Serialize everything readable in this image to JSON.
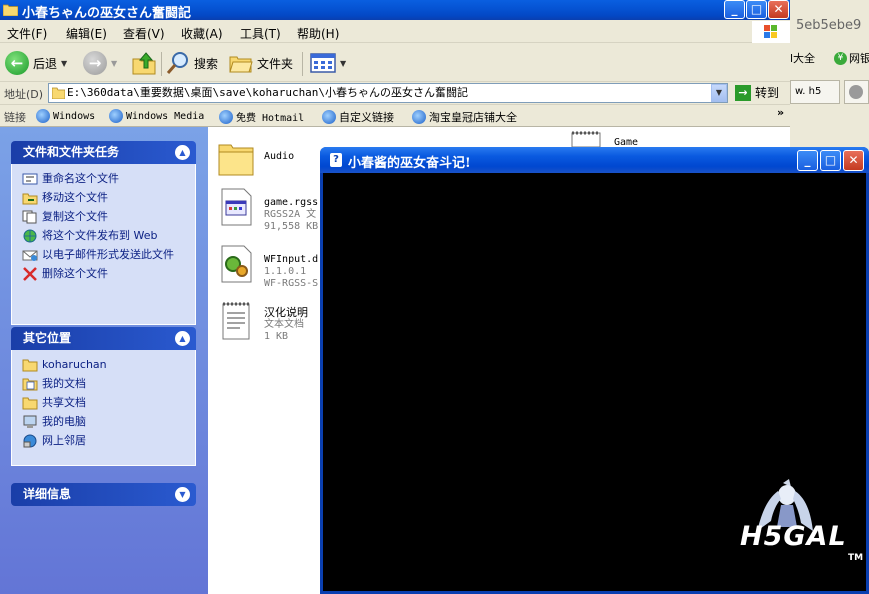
{
  "explorer": {
    "title": "小春ちゃんの巫女さん奮闘記",
    "window_buttons": [
      "minimize",
      "maximize",
      "close"
    ],
    "menu": [
      "文件(F)",
      "编辑(E)",
      "查看(V)",
      "收藏(A)",
      "工具(T)",
      "帮助(H)"
    ],
    "toolbar": {
      "back_label": "后退",
      "search_label": "搜索",
      "folders_label": "文件夹"
    },
    "address": {
      "label": "地址(D)",
      "value": "E:\\360data\\重要数据\\桌面\\save\\koharuchan\\小春ちゃんの巫女さん奮闘記",
      "go_label": "转到"
    },
    "links": {
      "label": "链接",
      "items": [
        "Windows",
        "Windows Media",
        "免费 Hotmail",
        "自定义链接",
        "淘宝皇冠店铺大全"
      ],
      "more": "»"
    },
    "sidebar": {
      "tasks": {
        "title": "文件和文件夹任务",
        "items": [
          "重命名这个文件",
          "移动这个文件",
          "复制这个文件",
          "将这个文件发布到 Web",
          "以电子邮件形式发送此文件",
          "删除这个文件"
        ]
      },
      "places": {
        "title": "其它位置",
        "items": [
          "koharuchan",
          "我的文档",
          "共享文档",
          "我的电脑",
          "网上邻居"
        ]
      },
      "details": {
        "title": "详细信息"
      }
    },
    "files": [
      {
        "name": "Audio",
        "line2": "",
        "line3": ""
      },
      {
        "name": "game.rgss",
        "line2": "RGSS2A 文",
        "line3": "91,558 KB"
      },
      {
        "name": "WFInput.d",
        "line2": "1.1.0.1",
        "line3": "WF-RGSS-S"
      },
      {
        "name": "汉化说明",
        "line2": "文本文档",
        "line3": "1 KB"
      },
      {
        "name": "Game",
        "line2": "",
        "line3": ""
      }
    ]
  },
  "background_window": {
    "hash_text": "5eb5ebe9",
    "btn1": "l大全",
    "btn2": "网银",
    "tabs": [
      "w. h5",
      ""
    ]
  },
  "game_window": {
    "title": "小春酱的巫女奋斗记!",
    "title_icon": "?",
    "logo": "H5GAL",
    "logo_tm": "TM"
  }
}
